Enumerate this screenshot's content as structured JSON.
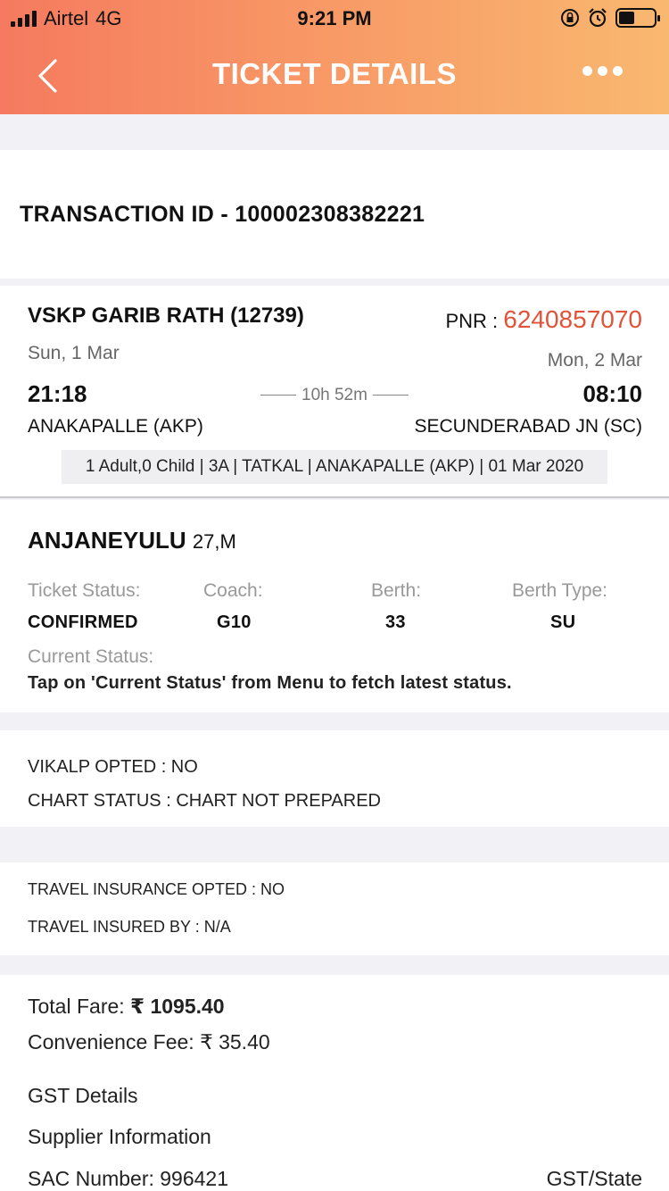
{
  "status_bar": {
    "carrier": "Airtel",
    "network": "4G",
    "time": "9:21 PM",
    "battery_level": 0.45
  },
  "header": {
    "title": "TICKET DETAILS"
  },
  "transaction": {
    "label": "TRANSACTION ID - 100002308382221"
  },
  "train": {
    "name": "VSKP GARIB RATH (12739)",
    "pnr_label": "PNR : ",
    "pnr": "6240857070",
    "departure_date": "Sun, 1 Mar",
    "arrival_date": "Mon, 2 Mar",
    "departure_time": "21:18",
    "arrival_time": "08:10",
    "duration": "10h 52m",
    "departure_station": "ANAKAPALLE (AKP)",
    "arrival_station": "SECUNDERABAD JN (SC)",
    "journey_info": "1 Adult,0 Child | 3A | TATKAL | ANAKAPALLE (AKP) | 01 Mar 2020"
  },
  "passenger": {
    "name": "ANJANEYULU",
    "age_gender": "27,M",
    "ticket_status_label": "Ticket Status:",
    "ticket_status": "CONFIRMED",
    "coach_label": "Coach:",
    "coach": "G10",
    "berth_label": "Berth:",
    "berth": "33",
    "berth_type_label": "Berth Type:",
    "berth_type": "SU",
    "current_status_label": "Current Status:",
    "current_status_msg": "Tap on 'Current Status' from Menu to fetch latest status."
  },
  "booking": {
    "vikalp": "VIKALP OPTED : NO",
    "chart_status": "CHART STATUS : CHART NOT PREPARED"
  },
  "insurance": {
    "opted": "TRAVEL INSURANCE OPTED : NO",
    "insured_by": "TRAVEL INSURED BY : N/A"
  },
  "fare": {
    "total_label": "Total Fare: ",
    "total": "₹ 1095.40",
    "convenience_label": "Convenience Fee: ",
    "convenience": "₹ 35.40",
    "gst_details": "GST Details",
    "supplier_info": "Supplier Information",
    "sac_number": "SAC Number: 996421",
    "gst_state": "GST/State"
  }
}
